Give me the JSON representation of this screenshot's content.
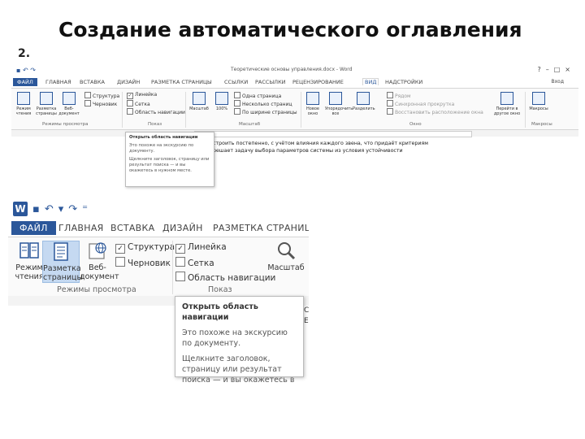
{
  "slide": {
    "title": "Создание автоматического оглавления",
    "number": "2."
  },
  "shot1": {
    "window_title": "Теоретические основы управления.docx - Word",
    "user": "Вход",
    "qat_icons": [
      "save-icon",
      "undo-icon",
      "redo-icon"
    ],
    "tabs": [
      "ФАЙЛ",
      "ГЛАВНАЯ",
      "ВСТАВКА",
      "ДИЗАЙН",
      "РАЗМЕТКА СТРАНИЦЫ",
      "ССЫЛКИ",
      "РАССЫЛКИ",
      "РЕЦЕНЗИРОВАНИЕ",
      "ВИД",
      "НАДСТРОЙКИ"
    ],
    "active_tab": "ВИД",
    "buttons": [
      {
        "label": "Режим чтения"
      },
      {
        "label": "Разметка страницы"
      },
      {
        "label": "Веб-документ"
      },
      {
        "label": "Масштаб"
      },
      {
        "label": "100%"
      },
      {
        "label": "Новое окно"
      },
      {
        "label": "Упорядочить все"
      },
      {
        "label": "Разделить"
      },
      {
        "label": "Перейти в другое окно"
      },
      {
        "label": "Макросы"
      }
    ],
    "checkboxes": [
      {
        "label": "Структура",
        "checked": false
      },
      {
        "label": "Черновик",
        "checked": false
      },
      {
        "label": "Линейка",
        "checked": true
      },
      {
        "label": "Сетка",
        "checked": false
      },
      {
        "label": "Область навигации",
        "checked": false
      },
      {
        "label": "Одна страница",
        "checked": false
      },
      {
        "label": "Несколько страниц",
        "checked": false
      },
      {
        "label": "По ширине страницы",
        "checked": false
      },
      {
        "label": "Рядом",
        "checked": false
      },
      {
        "label": "Синхронная прокрутка",
        "checked": false
      },
      {
        "label": "Восстановить расположение окна",
        "checked": false
      }
    ],
    "groups": [
      "Режимы просмотра",
      "Показ",
      "Масштаб",
      "Окно",
      "Макросы"
    ],
    "doc_lines": [
      "строить постепенно, с учётом влияния каждого звена, что придаёт критериям",
      "решает задачу выбора параметров системы из условия устойчивости"
    ],
    "tooltip": {
      "title": "Открыть область навигации",
      "line1": "Это похоже на экскурсию по документу.",
      "line2": "Щелкните заголовок, страницу или результат поиска — и вы окажетесь в нужном месте."
    }
  },
  "shot2": {
    "app_icon": "W",
    "tabs": [
      "ФАЙЛ",
      "ГЛАВНАЯ",
      "ВСТАВКА",
      "ДИЗАЙН",
      "РАЗМЕТКА СТРАНИЦЫ"
    ],
    "buttons": [
      {
        "label_1": "Режим",
        "label_2": "чтения"
      },
      {
        "label_1": "Разметка",
        "label_2": "страницы"
      },
      {
        "label_1": "Веб-",
        "label_2": "документ"
      },
      {
        "label_1": "Масштаб",
        "label_2": ""
      }
    ],
    "checkboxes": [
      {
        "label": "Структура",
        "checked": true
      },
      {
        "label": "Черновик",
        "checked": false
      },
      {
        "label": "Линейка",
        "checked": true
      },
      {
        "label": "Сетка",
        "checked": false
      },
      {
        "label": "Область навигации",
        "checked": false
      }
    ],
    "groups": [
      "Режимы просмотра",
      "Показ"
    ],
    "tooltip": {
      "title": "Открыть область навигации",
      "line1": "Это похоже на экскурсию по документу.",
      "line2": "Щелкните заголовок, страницу или результат поиска — и вы окажетесь в нужном месте."
    },
    "edge_chars": [
      "С",
      "Е"
    ],
    "accent": "#2b579a",
    "selected_button": "Разметка страницы"
  }
}
